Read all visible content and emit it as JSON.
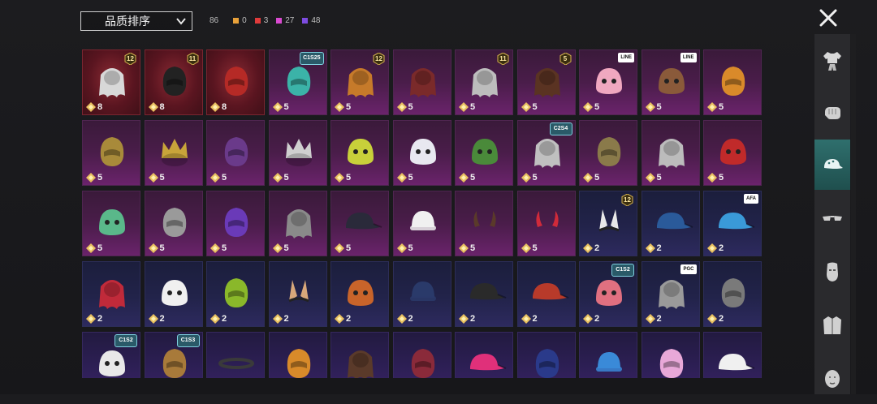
{
  "sort": {
    "label": "品质排序"
  },
  "counts": {
    "total": "86",
    "groups": [
      {
        "color": "#e8a13a",
        "value": "0"
      },
      {
        "color": "#e03b3b",
        "value": "3"
      },
      {
        "color": "#d94ad0",
        "value": "27"
      },
      {
        "color": "#7d4ce0",
        "value": "48"
      }
    ]
  },
  "sidebar": {
    "items": [
      {
        "icon": "outfit-icon"
      },
      {
        "icon": "gloves-icon"
      },
      {
        "icon": "cap-icon",
        "active": true
      },
      {
        "icon": "glasses-icon"
      },
      {
        "icon": "mask-icon"
      },
      {
        "icon": "jacket-icon"
      },
      {
        "icon": "face-icon"
      }
    ]
  },
  "items": [
    {
      "quality": "red",
      "art": "white-wig",
      "color": "#d8d8d8",
      "points": "8",
      "level": "12"
    },
    {
      "quality": "red",
      "art": "black-helmet",
      "color": "#222222",
      "points": "8",
      "level": "11"
    },
    {
      "quality": "red",
      "art": "red-helmet",
      "color": "#b52a26",
      "points": "8"
    },
    {
      "quality": "purple",
      "art": "cat-headphones",
      "color": "#3bb3a8",
      "points": "5",
      "tag": "C1S25"
    },
    {
      "quality": "purple",
      "art": "orange-hair",
      "color": "#c67a2a",
      "points": "5",
      "level": "12"
    },
    {
      "quality": "purple",
      "art": "red-hair",
      "color": "#7a2a2a",
      "points": "5"
    },
    {
      "quality": "purple",
      "art": "flower-veil",
      "color": "#bdbdbd",
      "points": "5",
      "level": "11"
    },
    {
      "quality": "purple",
      "art": "brown-hair",
      "color": "#5a3322",
      "points": "5",
      "level": "5"
    },
    {
      "quality": "purple",
      "art": "pink-pig-hat",
      "color": "#f0a8c0",
      "points": "5",
      "label_tag": "LINE"
    },
    {
      "quality": "purple",
      "art": "bear-pig-hat",
      "color": "#8a5a3a",
      "points": "5",
      "label_tag": "LINE"
    },
    {
      "quality": "purple",
      "art": "orange-head",
      "color": "#d98a2a",
      "points": "5"
    },
    {
      "quality": "purple",
      "art": "gold-mask",
      "color": "#a88a3a",
      "points": "5"
    },
    {
      "quality": "purple",
      "art": "gold-crown",
      "color": "#c8a43a",
      "points": "5"
    },
    {
      "quality": "purple",
      "art": "jewel-helmet",
      "color": "#6a3a8a",
      "points": "5"
    },
    {
      "quality": "purple",
      "art": "silver-crown",
      "color": "#cfcfcf",
      "points": "5"
    },
    {
      "quality": "purple",
      "art": "bucket-hat",
      "color": "#c8d03a",
      "points": "5"
    },
    {
      "quality": "purple",
      "art": "bunny-hood",
      "color": "#e8e8f0",
      "points": "5"
    },
    {
      "quality": "purple",
      "art": "green-beast-hat",
      "color": "#4a8a3a",
      "points": "5"
    },
    {
      "quality": "purple",
      "art": "silver-wig",
      "color": "#c0c0c0",
      "points": "5",
      "tag": "C2S4"
    },
    {
      "quality": "purple",
      "art": "bronze-helmet",
      "color": "#8a7a4a",
      "points": "5"
    },
    {
      "quality": "purple",
      "art": "grey-wig",
      "color": "#bcbcbc",
      "points": "5"
    },
    {
      "quality": "purple",
      "art": "red-glove-hat",
      "color": "#c02a2a",
      "points": "5"
    },
    {
      "quality": "purple",
      "art": "gift-box-hat",
      "color": "#5ab88a",
      "points": "5"
    },
    {
      "quality": "purple",
      "art": "knight-helmet",
      "color": "#9a9a9a",
      "points": "5"
    },
    {
      "quality": "purple",
      "art": "violet-helmet",
      "color": "#6a3ab8",
      "points": "5"
    },
    {
      "quality": "purple",
      "art": "dread-hair",
      "color": "#8a8a8a",
      "points": "5"
    },
    {
      "quality": "purple",
      "art": "black-visor",
      "color": "#2a2a3a",
      "points": "5"
    },
    {
      "quality": "purple",
      "art": "white-beanie",
      "color": "#f0f0f0",
      "points": "5"
    },
    {
      "quality": "purple",
      "art": "thin-horns",
      "color": "#5a3a2a",
      "points": "5"
    },
    {
      "quality": "purple",
      "art": "red-horns",
      "color": "#d02a3a",
      "points": "5"
    },
    {
      "quality": "blue",
      "art": "bunny-ears",
      "color": "#e8e8e8",
      "points": "2",
      "level": "12"
    },
    {
      "quality": "blue",
      "art": "blue-cap",
      "color": "#2a5a9a",
      "points": "2"
    },
    {
      "quality": "blue",
      "art": "light-blue-cap",
      "color": "#3a9ad8",
      "points": "2",
      "label_tag": "AFA"
    },
    {
      "quality": "blue",
      "art": "red-bow-hair",
      "color": "#c02a3a",
      "points": "2"
    },
    {
      "quality": "blue",
      "art": "white-sunhat",
      "color": "#f0f0f0",
      "points": "2"
    },
    {
      "quality": "blue",
      "art": "green-helmet",
      "color": "#8ab82a",
      "points": "2"
    },
    {
      "quality": "blue",
      "art": "cat-ears",
      "color": "#d8a87a",
      "points": "2"
    },
    {
      "quality": "blue",
      "art": "orange-hood",
      "color": "#c8642a",
      "points": "2"
    },
    {
      "quality": "blue",
      "art": "navy-beanie",
      "color": "#2a3a6a",
      "points": "2"
    },
    {
      "quality": "blue",
      "art": "black-cap",
      "color": "#2a2a2a",
      "points": "2"
    },
    {
      "quality": "blue",
      "art": "red-cap",
      "color": "#b83a2a",
      "points": "2"
    },
    {
      "quality": "blue",
      "art": "pink-bandana",
      "color": "#e07080",
      "points": "2",
      "tag": "C1S2"
    },
    {
      "quality": "blue",
      "art": "grey-hair",
      "color": "#9a9a9a",
      "points": "2",
      "label_tag": "PGC"
    },
    {
      "quality": "blue",
      "art": "grey-helmet",
      "color": "#7a7a7a",
      "points": "2"
    },
    {
      "quality": "violet",
      "art": "chef-hat",
      "color": "#e8e8e8",
      "points": "",
      "tag": "C1S2"
    },
    {
      "quality": "violet",
      "art": "bronze-mech",
      "color": "#a87a3a",
      "points": "",
      "tag": "C1S3"
    },
    {
      "quality": "violet",
      "art": "halo",
      "color": "#3a3a3a",
      "points": ""
    },
    {
      "quality": "violet",
      "art": "jeweled-mask",
      "color": "#d88a2a",
      "points": ""
    },
    {
      "quality": "violet",
      "art": "long-hair",
      "color": "#5a3a2a",
      "points": ""
    },
    {
      "quality": "violet",
      "art": "demon-mask",
      "color": "#8a2a3a",
      "points": ""
    },
    {
      "quality": "violet",
      "art": "pink-cap",
      "color": "#e0307a",
      "points": ""
    },
    {
      "quality": "violet",
      "art": "navy-helmet",
      "color": "#2a3a8a",
      "points": ""
    },
    {
      "quality": "violet",
      "art": "blue-beanie",
      "color": "#3a8ad8",
      "points": ""
    },
    {
      "quality": "violet",
      "art": "cat-headset",
      "color": "#e8a8d8",
      "points": ""
    },
    {
      "quality": "violet",
      "art": "white-visor",
      "color": "#f0f0f0",
      "points": ""
    }
  ]
}
